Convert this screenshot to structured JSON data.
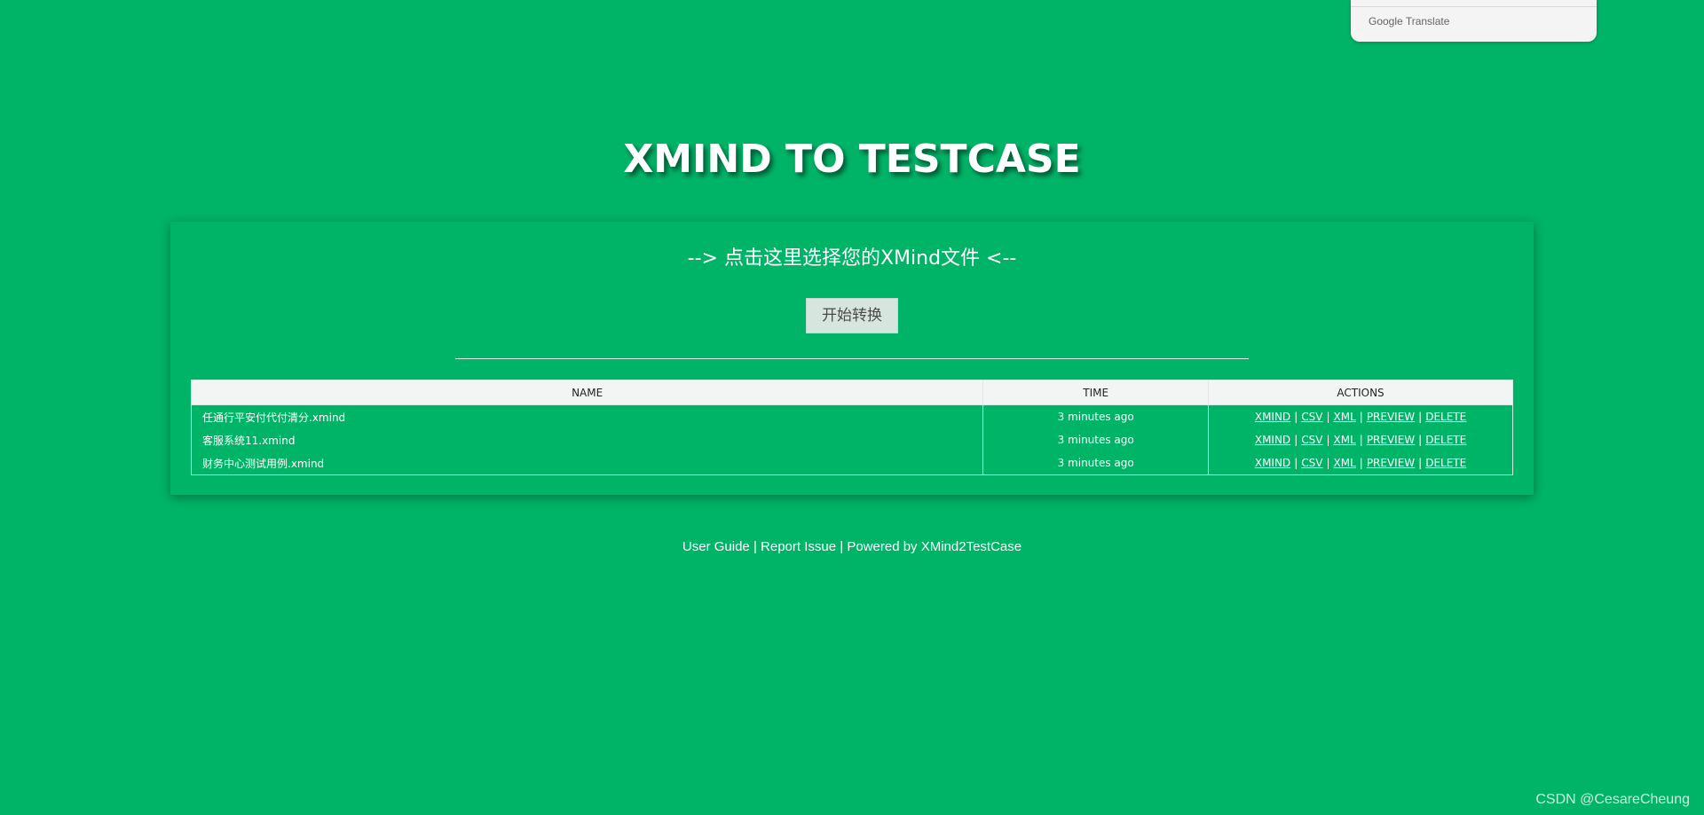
{
  "google_translate": {
    "brand_google": "Google",
    "brand_translate": "Translate"
  },
  "header": {
    "title": "XMIND TO TESTCASE"
  },
  "upload": {
    "select_file_text": "--> 点击这里选择您的XMind文件 <--",
    "convert_button_label": "开始转换"
  },
  "table": {
    "columns": [
      "NAME",
      "TIME",
      "ACTIONS"
    ],
    "rows": [
      {
        "name": "任通行平安付代付清分.xmind",
        "time": "3 minutes ago",
        "actions": [
          "XMIND",
          "CSV",
          "XML",
          "PREVIEW",
          "DELETE"
        ]
      },
      {
        "name": "客服系统11.xmind",
        "time": "3 minutes ago",
        "actions": [
          "XMIND",
          "CSV",
          "XML",
          "PREVIEW",
          "DELETE"
        ]
      },
      {
        "name": "财务中心测试用例.xmind",
        "time": "3 minutes ago",
        "actions": [
          "XMIND",
          "CSV",
          "XML",
          "PREVIEW",
          "DELETE"
        ]
      }
    ],
    "action_separator": "|"
  },
  "footer": {
    "user_guide": "User Guide",
    "report_issue": "Report Issue",
    "powered_by": "Powered by XMind2TestCase",
    "separator": "|"
  },
  "watermark": "CSDN @CesareCheung",
  "colors": {
    "background": "#00b467",
    "header_row": "#f3f5f4",
    "button": "#d6e6de"
  },
  "icons": {
    "google_translate": "google-translate-logo"
  }
}
